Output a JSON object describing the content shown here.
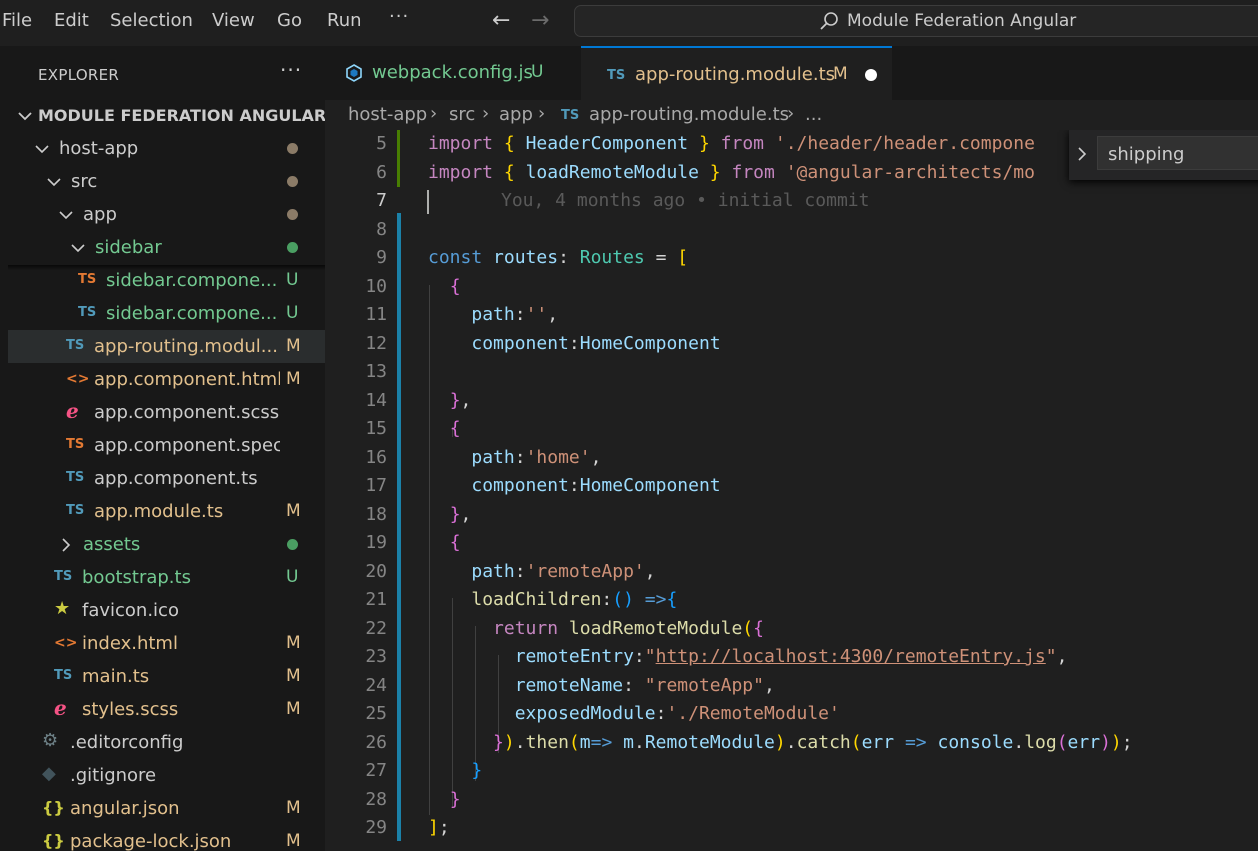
{
  "menu": {
    "items": [
      "File",
      "Edit",
      "Selection",
      "View",
      "Go",
      "Run"
    ],
    "more": "···"
  },
  "titlebar": {
    "search_text": "Module Federation Angular"
  },
  "explorer": {
    "title": "EXPLORER",
    "more": "···",
    "root": "MODULE FEDERATION ANGULAR",
    "items": [
      {
        "label": "host-app",
        "type": "folder",
        "open": true,
        "status": "dot",
        "color": "#cccccc",
        "dot_color": "#8b7b67"
      },
      {
        "label": "src",
        "type": "folder",
        "open": true,
        "status": "dot",
        "color": "#cccccc",
        "dot_color": "#8b7b67"
      },
      {
        "label": "app",
        "type": "folder",
        "open": true,
        "status": "dot",
        "color": "#cccccc",
        "dot_color": "#8b7b67"
      },
      {
        "label": "sidebar",
        "type": "folder",
        "open": true,
        "status": "dot",
        "color": "#73c991",
        "dot_color": "#4a9e62"
      },
      {
        "label": "sidebar.compone...",
        "type": "ts",
        "icon_color": "#e37933",
        "status": "U",
        "color": "#73c991",
        "status_color": "#73c991"
      },
      {
        "label": "sidebar.compone...",
        "type": "ts",
        "icon_color": "#519aba",
        "status": "U",
        "color": "#73c991",
        "status_color": "#73c991"
      },
      {
        "label": "app-routing.modul...",
        "type": "ts",
        "icon_color": "#519aba",
        "status": "M",
        "color": "#e2c08d",
        "status_color": "#e2c08d",
        "selected": true
      },
      {
        "label": "app.component.html",
        "type": "html",
        "icon_color": "#e37933",
        "status": "M",
        "color": "#e2c08d",
        "status_color": "#e2c08d"
      },
      {
        "label": "app.component.scss",
        "type": "scss",
        "icon_color": "#f55385",
        "status": "",
        "color": "#cccccc"
      },
      {
        "label": "app.component.spec.ts",
        "type": "ts",
        "icon_color": "#e37933",
        "status": "",
        "color": "#cccccc"
      },
      {
        "label": "app.component.ts",
        "type": "ts",
        "icon_color": "#519aba",
        "status": "",
        "color": "#cccccc"
      },
      {
        "label": "app.module.ts",
        "type": "ts",
        "icon_color": "#519aba",
        "status": "M",
        "color": "#e2c08d",
        "status_color": "#e2c08d"
      },
      {
        "label": "assets",
        "type": "folder",
        "open": false,
        "status": "dot",
        "color": "#73c991",
        "dot_color": "#4a9e62"
      },
      {
        "label": "bootstrap.ts",
        "type": "ts",
        "icon_color": "#519aba",
        "status": "U",
        "color": "#73c991",
        "status_color": "#73c991"
      },
      {
        "label": "favicon.ico",
        "type": "star",
        "icon_color": "#cbcb41",
        "status": "",
        "color": "#cccccc"
      },
      {
        "label": "index.html",
        "type": "html",
        "icon_color": "#e37933",
        "status": "M",
        "color": "#e2c08d",
        "status_color": "#e2c08d"
      },
      {
        "label": "main.ts",
        "type": "ts",
        "icon_color": "#519aba",
        "status": "M",
        "color": "#e2c08d",
        "status_color": "#e2c08d"
      },
      {
        "label": "styles.scss",
        "type": "scss",
        "icon_color": "#f55385",
        "status": "M",
        "color": "#e2c08d",
        "status_color": "#e2c08d"
      },
      {
        "label": ".editorconfig",
        "type": "gear",
        "icon_color": "#6d8086",
        "status": "",
        "color": "#cccccc"
      },
      {
        "label": ".gitignore",
        "type": "git",
        "icon_color": "#41535b",
        "status": "",
        "color": "#cccccc"
      },
      {
        "label": "angular.json",
        "type": "json",
        "icon_color": "#cbcb41",
        "status": "M",
        "color": "#e2c08d",
        "status_color": "#e2c08d"
      },
      {
        "label": "package-lock.json",
        "type": "json",
        "icon_color": "#cbcb41",
        "status": "M",
        "color": "#e2c08d",
        "status_color": "#e2c08d"
      }
    ]
  },
  "tabs": [
    {
      "label": "webpack.config.js",
      "status": "U",
      "icon": "webpack-icon",
      "label_color": "#73c991",
      "status_color": "#73c991"
    },
    {
      "label": "app-routing.module.ts",
      "status": "M",
      "icon": "ts-icon",
      "label_color": "#e2c08d",
      "status_color": "#e2c08d",
      "active": true,
      "dirty": true
    }
  ],
  "breadcrumb": [
    "host-app",
    "src",
    "app",
    "app-routing.module.ts",
    "..."
  ],
  "editor": {
    "blame": "You, 4 months ago • initial commit",
    "line_numbers": [
      "5",
      "6",
      "7",
      "8",
      "9",
      "10",
      "11",
      "12",
      "13",
      "14",
      "15",
      "16",
      "17",
      "18",
      "19",
      "20",
      "21",
      "22",
      "23",
      "24",
      "25",
      "26",
      "27",
      "28",
      "29"
    ],
    "active_line": "7"
  },
  "find_widget": {
    "value": "shipping"
  }
}
